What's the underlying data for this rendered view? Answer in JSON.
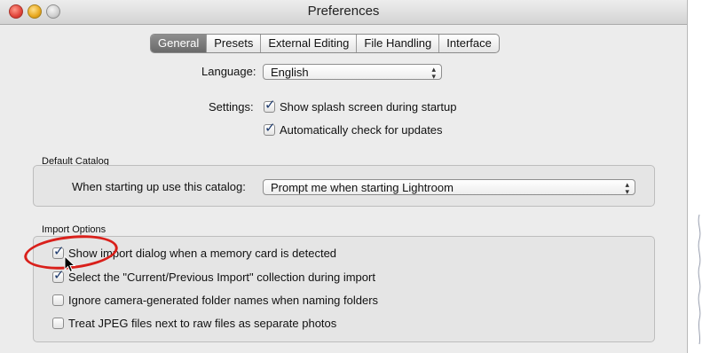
{
  "window": {
    "title": "Preferences"
  },
  "tabs": [
    {
      "label": "General",
      "active": true
    },
    {
      "label": "Presets",
      "active": false
    },
    {
      "label": "External Editing",
      "active": false
    },
    {
      "label": "File Handling",
      "active": false
    },
    {
      "label": "Interface",
      "active": false
    }
  ],
  "general": {
    "language_label": "Language:",
    "language_value": "English",
    "settings_label": "Settings:",
    "splash_label": "Show splash screen during startup",
    "splash_checked": true,
    "updates_label": "Automatically check for updates",
    "updates_checked": true
  },
  "default_catalog": {
    "group_title": "Default Catalog",
    "startup_label": "When starting up use this catalog:",
    "startup_value": "Prompt me when starting Lightroom"
  },
  "import_options": {
    "group_title": "Import Options",
    "items": [
      {
        "label": "Show import dialog when a memory card is detected",
        "checked": true
      },
      {
        "label": "Select the \"Current/Previous Import\" collection during import",
        "checked": true
      },
      {
        "label": "Ignore camera-generated folder names when naming folders",
        "checked": false
      },
      {
        "label": "Treat JPEG files next to raw files as separate photos",
        "checked": false
      }
    ]
  },
  "colors": {
    "annotation_circle": "#d9201b",
    "active_tab": "#7a7a7a",
    "checkmark": "#1e3b6e"
  }
}
